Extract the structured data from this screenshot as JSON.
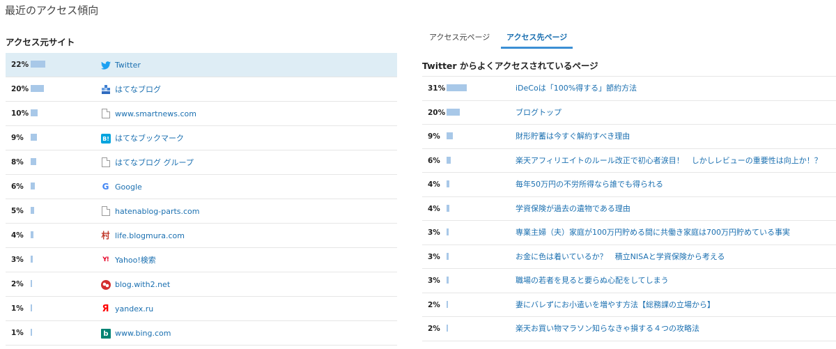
{
  "page_title": "最近のアクセス傾向",
  "left": {
    "heading": "アクセス元サイト",
    "rows": [
      {
        "pct": "22%",
        "value": 22,
        "icon": "twitter-icon",
        "name": "Twitter"
      },
      {
        "pct": "20%",
        "value": 20,
        "icon": "hatena-blog-icon",
        "name": "はてなブログ"
      },
      {
        "pct": "10%",
        "value": 10,
        "icon": "file-icon",
        "name": "www.smartnews.com"
      },
      {
        "pct": "9%",
        "value": 9,
        "icon": "hatena-bookmark-icon",
        "name": "はてなブックマーク"
      },
      {
        "pct": "8%",
        "value": 8,
        "icon": "file-icon",
        "name": "はてなブログ グループ"
      },
      {
        "pct": "6%",
        "value": 6,
        "icon": "google-icon",
        "name": "Google"
      },
      {
        "pct": "5%",
        "value": 5,
        "icon": "file-icon",
        "name": "hatenablog-parts.com"
      },
      {
        "pct": "4%",
        "value": 4,
        "icon": "blogmura-icon",
        "name": "life.blogmura.com"
      },
      {
        "pct": "3%",
        "value": 3,
        "icon": "yahoo-icon",
        "name": "Yahoo!検索"
      },
      {
        "pct": "2%",
        "value": 2,
        "icon": "with2-icon",
        "name": "blog.with2.net"
      },
      {
        "pct": "1%",
        "value": 1,
        "icon": "yandex-icon",
        "name": "yandex.ru"
      },
      {
        "pct": "1%",
        "value": 1,
        "icon": "bing-icon",
        "name": "www.bing.com"
      }
    ],
    "icon_glyphs": {
      "google": "G",
      "blogmura": "村",
      "yahoo": "Y!",
      "yandex": "Я",
      "bing": "b",
      "hatena_bookmark": "B!"
    }
  },
  "right": {
    "tabs": [
      {
        "label": "アクセス元ページ",
        "active": false
      },
      {
        "label": "アクセス先ページ",
        "active": true
      }
    ],
    "heading": "Twitter からよくアクセスされているページ",
    "rows": [
      {
        "pct": "31%",
        "value": 31,
        "title": "iDeCoは「100%得する」節約方法"
      },
      {
        "pct": "20%",
        "value": 20,
        "title": "ブログトップ"
      },
      {
        "pct": "9%",
        "value": 9,
        "title": "財形貯蓄は今すぐ解約すべき理由"
      },
      {
        "pct": "6%",
        "value": 6,
        "title": "楽天アフィリエイトのルール改正で初心者涙目！　しかしレビューの重要性は向上か！？"
      },
      {
        "pct": "4%",
        "value": 4,
        "title": "毎年50万円の不労所得なら誰でも得られる"
      },
      {
        "pct": "4%",
        "value": 4,
        "title": "学資保険が過去の遺物である理由"
      },
      {
        "pct": "3%",
        "value": 3,
        "title": "専業主婦（夫）家庭が100万円貯める間に共働き家庭は700万円貯めている事実"
      },
      {
        "pct": "3%",
        "value": 3,
        "title": "お金に色は着いているか？　積立NISAと学資保険から考える"
      },
      {
        "pct": "3%",
        "value": 3,
        "title": "職場の若者を見ると要らぬ心配をしてしまう"
      },
      {
        "pct": "2%",
        "value": 2,
        "title": "妻にバレずにお小遣いを増やす方法【総務課の立場から】"
      },
      {
        "pct": "2%",
        "value": 2,
        "title": "楽天お買い物マラソン知らなきゃ損する４つの攻略法"
      }
    ]
  },
  "colors": {
    "bar": "#a8c8e8",
    "link": "#1a6fb0",
    "highlight_row": "#deedf5",
    "active_tab_underline": "#3b8fd4"
  }
}
